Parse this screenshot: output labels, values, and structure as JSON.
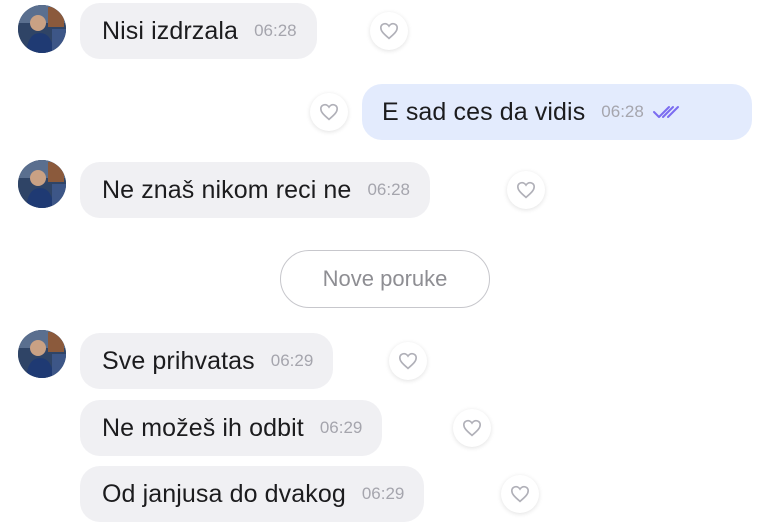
{
  "chat": {
    "messages": [
      {
        "direction": "incoming",
        "text": "Nisi izdrzala",
        "time": "06:28"
      },
      {
        "direction": "outgoing",
        "text": "E sad ces da vidis",
        "time": "06:28",
        "status_icon": "double-check-icon"
      },
      {
        "direction": "incoming",
        "text": "Ne znaš nikom reci ne",
        "time": "06:28"
      },
      {
        "direction": "incoming",
        "text": "Sve prihvatas",
        "time": "06:29"
      },
      {
        "direction": "incoming",
        "text": "Ne možeš ih odbit",
        "time": "06:29"
      },
      {
        "direction": "incoming",
        "text": "Od janjusa do dvakog",
        "time": "06:29"
      }
    ],
    "new_messages_label": "Nove poruke"
  },
  "icons": {
    "like": "heart-outline-icon",
    "read_receipt": "double-check-icon",
    "avatar": "contact-avatar"
  },
  "colors": {
    "incoming_bubble": "#f0f0f3",
    "outgoing_bubble": "#e3ebfd",
    "read_check": "#7b6cf0",
    "timestamp": "#a5a5ad"
  }
}
